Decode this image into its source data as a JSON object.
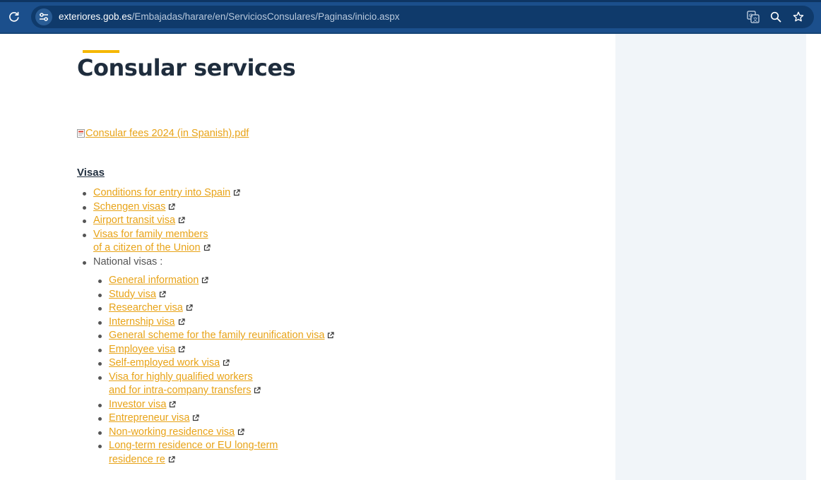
{
  "browser": {
    "url_domain": "exteriores.gob.es",
    "url_path": "/Embajadas/harare/en/ServiciosConsulares/Paginas/inicio.aspx"
  },
  "page": {
    "title": "Consular services",
    "pdf_link": "Consular fees 2024 (in Spanish).pdf",
    "visas_heading": "Visas",
    "visa_items": [
      {
        "line1": "Conditions for entry into Spain",
        "line2": ""
      },
      {
        "line1": "Schengen visas",
        "line2": ""
      },
      {
        "line1": "Airport transit visa",
        "line2": ""
      },
      {
        "line1": "Visas for family members",
        "line2": "of a citizen of the Union"
      }
    ],
    "national_label": "National visas :",
    "national_items": [
      {
        "line1": "General information",
        "line2": ""
      },
      {
        "line1": "Study visa",
        "line2": ""
      },
      {
        "line1": "Researcher visa",
        "line2": ""
      },
      {
        "line1": "Internship visa",
        "line2": ""
      },
      {
        "line1": "General scheme for the family reunification visa",
        "line2": ""
      },
      {
        "line1": "Employee visa",
        "line2": ""
      },
      {
        "line1": "Self-employed work visa",
        "line2": ""
      },
      {
        "line1": "Visa for highly qualified workers",
        "line2": "and for intra-company transfers"
      },
      {
        "line1": "Investor visa",
        "line2": ""
      },
      {
        "line1": "Entrepreneur visa",
        "line2": ""
      },
      {
        "line1": "Non-working residence visa",
        "line2": ""
      },
      {
        "line1": "Long-term residence or EU long-term",
        "line2": "residence re"
      }
    ]
  },
  "icons": {
    "reload": "reload-icon",
    "site_info": "tune-icon",
    "translate": "translate-icon",
    "zoom": "zoom-icon",
    "bookmark": "star-icon",
    "external": "external-link-icon",
    "pdf": "pdf-file-icon"
  },
  "colors": {
    "toolbar": "#1b4f8c",
    "omnibox": "#0f3a6b",
    "link": "#e8a317",
    "title_accent": "#f5b700",
    "heading": "#1f2d3d",
    "sidebar": "#f1f5f9"
  }
}
